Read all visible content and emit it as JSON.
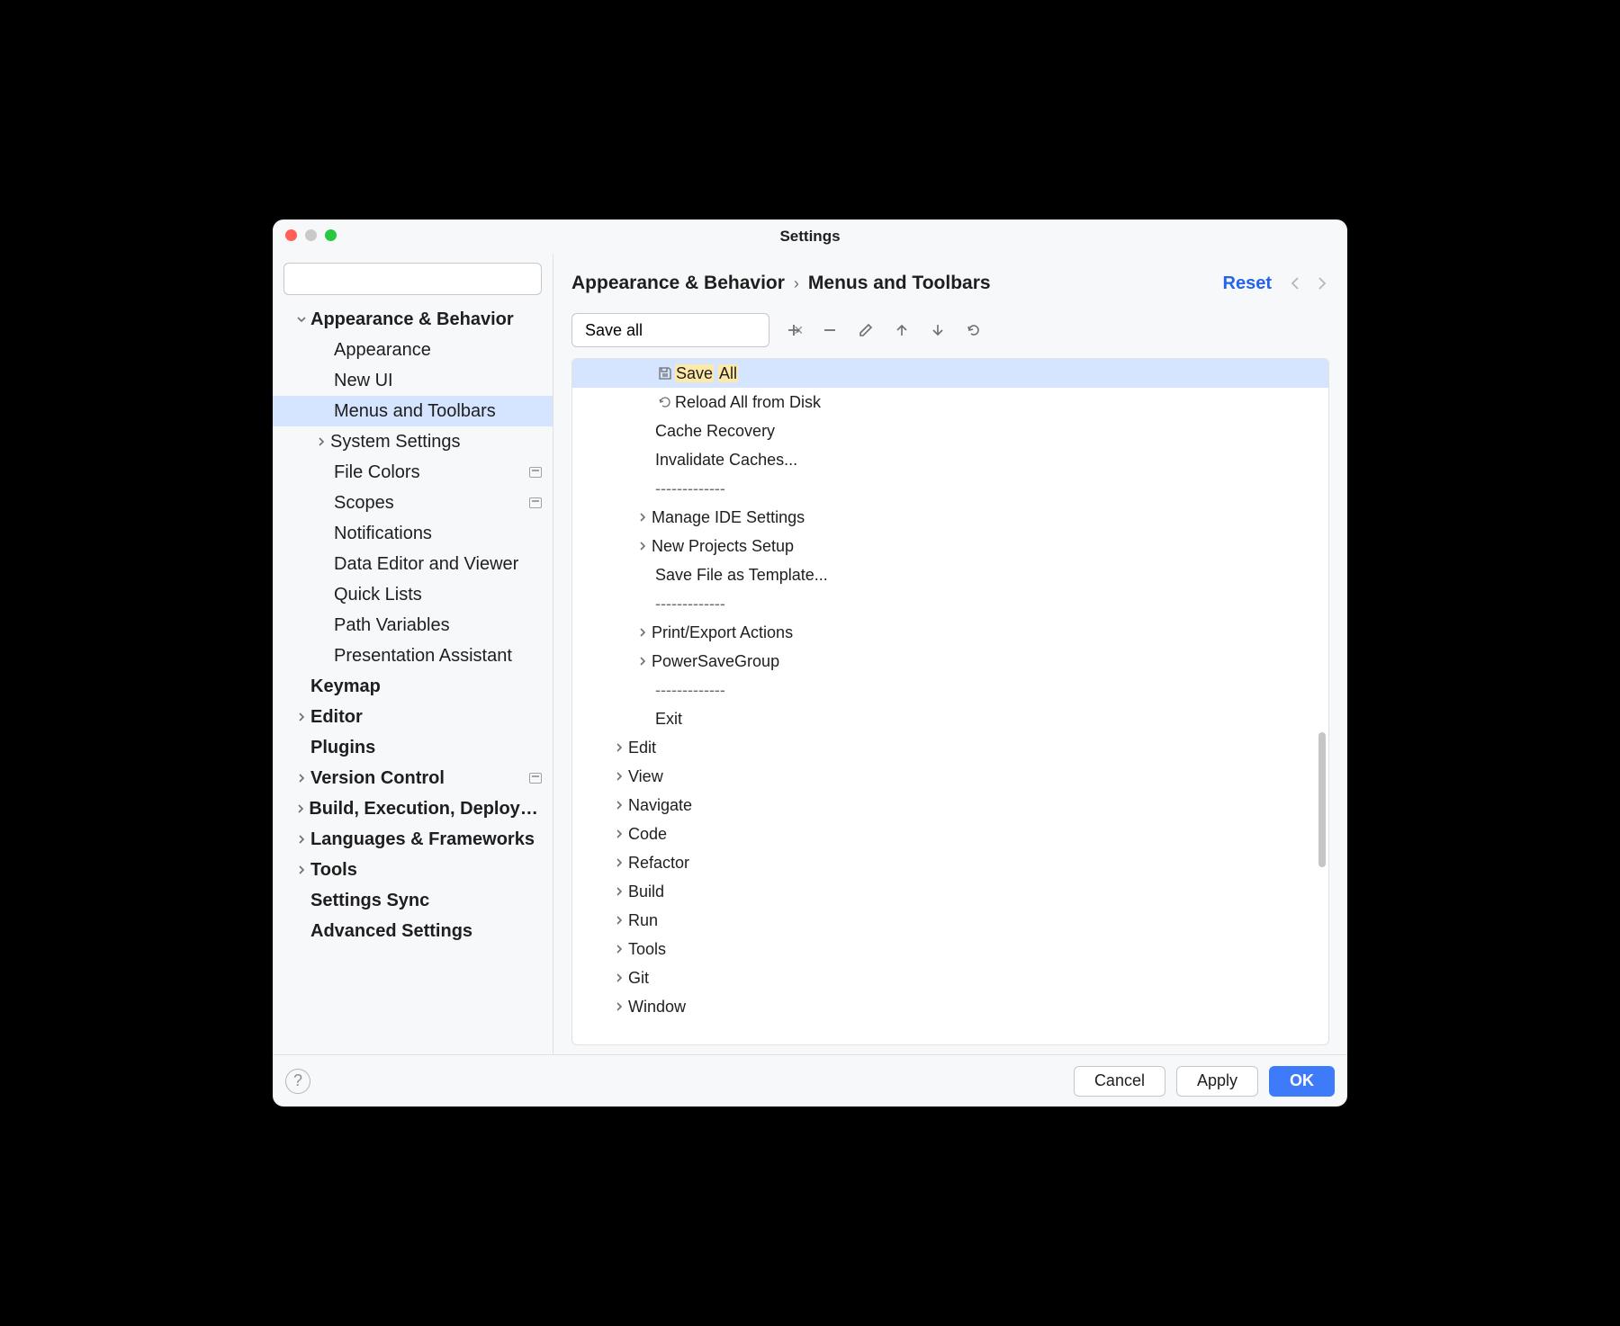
{
  "window": {
    "title": "Settings"
  },
  "sidebar": {
    "search_placeholder": "",
    "items": [
      {
        "label": "Appearance & Behavior",
        "bold": true,
        "indent": 1,
        "chev": "down"
      },
      {
        "label": "Appearance",
        "indent": 2
      },
      {
        "label": "New UI",
        "indent": 2
      },
      {
        "label": "Menus and Toolbars",
        "indent": 2,
        "selected": true
      },
      {
        "label": "System Settings",
        "indent": 2,
        "chev": "right"
      },
      {
        "label": "File Colors",
        "indent": 2,
        "badge": true
      },
      {
        "label": "Scopes",
        "indent": 2,
        "badge": true
      },
      {
        "label": "Notifications",
        "indent": 2
      },
      {
        "label": "Data Editor and Viewer",
        "indent": 2
      },
      {
        "label": "Quick Lists",
        "indent": 2
      },
      {
        "label": "Path Variables",
        "indent": 2
      },
      {
        "label": "Presentation Assistant",
        "indent": 2
      },
      {
        "label": "Keymap",
        "bold": true,
        "indent": 1
      },
      {
        "label": "Editor",
        "bold": true,
        "indent": 1,
        "chev": "right"
      },
      {
        "label": "Plugins",
        "bold": true,
        "indent": 1
      },
      {
        "label": "Version Control",
        "bold": true,
        "indent": 1,
        "chev": "right",
        "badge": true
      },
      {
        "label": "Build, Execution, Deployment",
        "bold": true,
        "indent": 1,
        "chev": "right"
      },
      {
        "label": "Languages & Frameworks",
        "bold": true,
        "indent": 1,
        "chev": "right"
      },
      {
        "label": "Tools",
        "bold": true,
        "indent": 1,
        "chev": "right"
      },
      {
        "label": "Settings Sync",
        "bold": true,
        "indent": 1
      },
      {
        "label": "Advanced Settings",
        "bold": true,
        "indent": 1
      }
    ]
  },
  "breadcrumb": {
    "parts": [
      "Appearance & Behavior",
      "Menus and Toolbars"
    ],
    "reset": "Reset"
  },
  "filter": {
    "value": "Save all"
  },
  "actions": [
    {
      "label_pre": "",
      "hl1": "Save",
      "mid": " ",
      "hl2": "All",
      "label_post": "",
      "indent": 1,
      "icon": "save",
      "selected": true
    },
    {
      "label": "Reload All from Disk",
      "indent": 1,
      "icon": "reload"
    },
    {
      "label": "Cache Recovery",
      "indent": 1
    },
    {
      "label": "Invalidate Caches...",
      "indent": 1
    },
    {
      "label": "-------------",
      "indent": 1,
      "sep": true
    },
    {
      "label": "Manage IDE Settings",
      "indent": 1,
      "chev": true
    },
    {
      "label": "New Projects Setup",
      "indent": 1,
      "chev": true
    },
    {
      "label": "Save File as Template...",
      "indent": 1
    },
    {
      "label": "-------------",
      "indent": 1,
      "sep": true
    },
    {
      "label": "Print/Export Actions",
      "indent": 1,
      "chev": true
    },
    {
      "label": "PowerSaveGroup",
      "indent": 1,
      "chev": true
    },
    {
      "label": "-------------",
      "indent": 1,
      "sep": true
    },
    {
      "label": "Exit",
      "indent": 1
    },
    {
      "label": "Edit",
      "indent": 0,
      "chev": true
    },
    {
      "label": "View",
      "indent": 0,
      "chev": true
    },
    {
      "label": "Navigate",
      "indent": 0,
      "chev": true
    },
    {
      "label": "Code",
      "indent": 0,
      "chev": true
    },
    {
      "label": "Refactor",
      "indent": 0,
      "chev": true
    },
    {
      "label": "Build",
      "indent": 0,
      "chev": true
    },
    {
      "label": "Run",
      "indent": 0,
      "chev": true
    },
    {
      "label": "Tools",
      "indent": 0,
      "chev": true
    },
    {
      "label": "Git",
      "indent": 0,
      "chev": true
    },
    {
      "label": "Window",
      "indent": 0,
      "chev": true
    }
  ],
  "footer": {
    "cancel": "Cancel",
    "apply": "Apply",
    "ok": "OK"
  }
}
